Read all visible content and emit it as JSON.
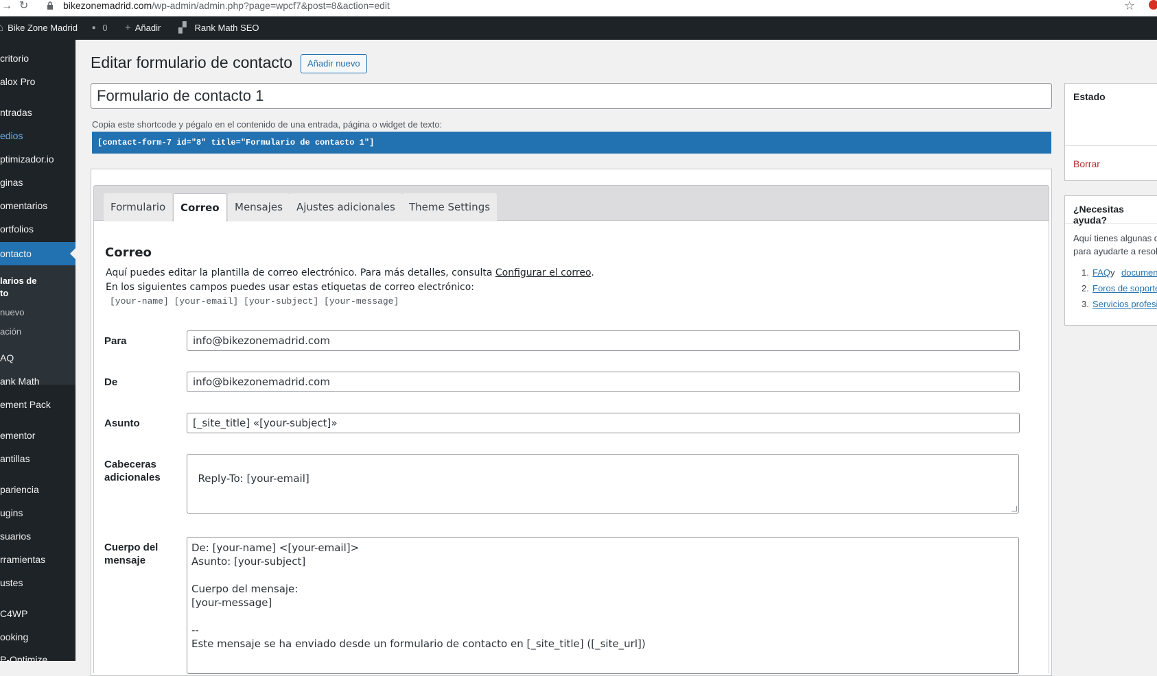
{
  "browser": {
    "url_domain": "bikezonemadrid.com",
    "url_path": "/wp-admin/admin.php?page=wpcf7&post=8&action=edit"
  },
  "adminbar": {
    "site_name": "Bike Zone Madrid",
    "comments_count": "0",
    "add_label": "Añadir",
    "rank_math_label": "Rank Math SEO"
  },
  "sidebar": {
    "items": [
      "critorio",
      "alox Pro",
      "ntradas",
      "edios",
      "ptimizador.io",
      "ginas",
      "omentarios",
      "ortfolios",
      "ontacto",
      "AQ",
      "ank Math",
      "ement Pack",
      "ementor",
      "antillas",
      "pariencia",
      "ugins",
      "suarios",
      "rramientas",
      "ustes",
      "C4WP",
      "ooking",
      "P-Optimize"
    ],
    "sub_items": [
      "larios de",
      "to",
      " nuevo",
      "ación"
    ]
  },
  "page": {
    "title": "Editar formulario de contacto",
    "add_new": "Añadir nuevo",
    "form_title": "Formulario de contacto 1",
    "shortcode_label": "Copia este shortcode y pégalo en el contenido de una entrada, página o widget de texto:",
    "shortcode": "[contact-form-7 id=\"8\" title=\"Formulario de contacto 1\"]"
  },
  "tabs": [
    "Formulario",
    "Correo",
    "Mensajes",
    "Ajustes adicionales",
    "Theme Settings"
  ],
  "mail": {
    "section_title": "Correo",
    "desc_prefix": "Aquí puedes editar la plantilla de correo electrónico. Para más detalles, consulta ",
    "desc_link": "Configurar el correo",
    "desc_suffix": ".",
    "desc2": "En los siguientes campos puedes usar estas etiquetas de correo electrónico:",
    "tags": "[your-name] [your-email] [your-subject] [your-message]",
    "to_label": "Para",
    "to_value": "info@bikezonemadrid.com",
    "from_label": "De",
    "from_value": "info@bikezonemadrid.com",
    "subject_label": "Asunto",
    "subject_value": "[_site_title] «[your-subject]»",
    "headers_label_1": "Cabeceras",
    "headers_label_2": "adicionales",
    "headers_value": "Reply-To: [your-email]",
    "body_label_1": "Cuerpo del",
    "body_label_2": "mensaje",
    "body_value": "De: [your-name] <[your-email]>\nAsunto: [your-subject]\n\nCuerpo del mensaje:\n[your-message]\n\n--\nEste mensaje se ha enviado desde un formulario de contacto en [_site_title] ([_site_url])"
  },
  "status_box": {
    "title": "Estado",
    "delete": "Borrar"
  },
  "help_box": {
    "title": "¿Necesitas ayuda?",
    "text_1": "Aquí tienes algunas d",
    "text_2": "para ayudarte a resol",
    "links": [
      {
        "num": "1.",
        "a": "FAQ",
        "mid": " y ",
        "b": "document"
      },
      {
        "num": "2.",
        "a": "Foros de soporte"
      },
      {
        "num": "3.",
        "a": "Servicios profesi"
      }
    ]
  }
}
